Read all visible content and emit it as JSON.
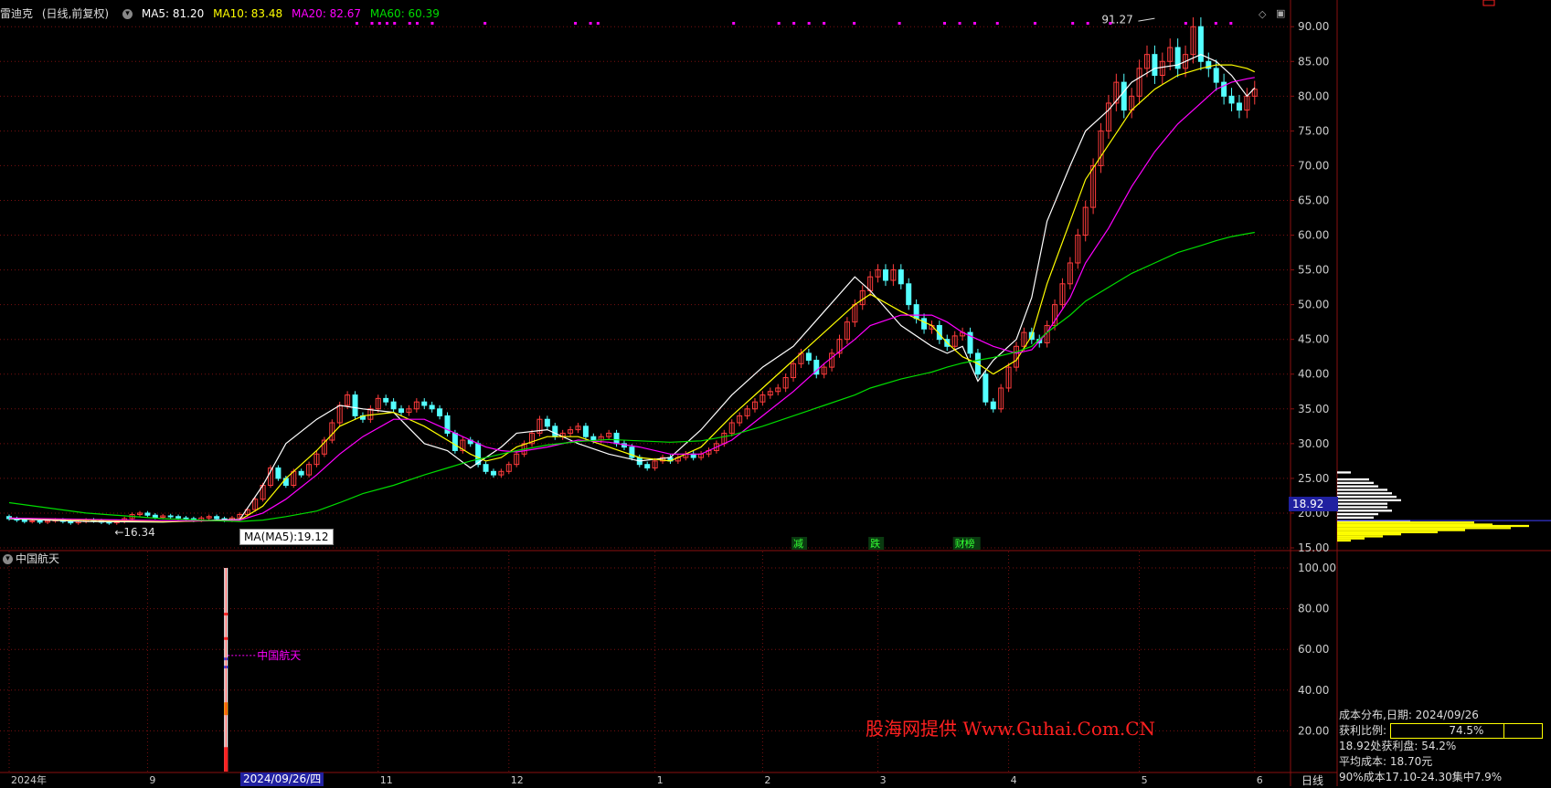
{
  "legend": {
    "stock_name": "雷迪克",
    "mode": "(日线,前复权)",
    "ma5": "MA5: 81.20",
    "ma10": "MA10: 83.48",
    "ma20": "MA20: 82.67",
    "ma60": "MA60: 60.39"
  },
  "colors": {
    "up": "#ff3c3c",
    "down": "#54ffff",
    "ma5": "#ffffff",
    "ma10": "#ffff00",
    "ma20": "#ff00ff",
    "ma60": "#00dd00",
    "grid": "#7a1010"
  },
  "sub_panel": {
    "title": "中国航天",
    "indicator_label": "中国航天"
  },
  "markers": {
    "high_label": "91.27",
    "low_label": "16.34",
    "ma_tooltip": "MA(MA5):19.12",
    "current_price": "18.92",
    "selected_date": "2024/09/26/四",
    "period": "日线",
    "event_tags": [
      "减",
      "跌",
      "财榜"
    ]
  },
  "cost_distribution": {
    "title": "成本分布,日期:  2024/09/26",
    "profit_ratio_label": "获利比例:",
    "profit_ratio_value": "74.5%",
    "profit_ratio": 0.745,
    "profit_at_price": "18.92处获利盘:  54.2%",
    "avg_cost": "平均成本:  18.70元",
    "concentration": "90%成本17.10-24.30集中7.9%"
  },
  "watermark": "股海网提供 Www.Guhai.Com.CN",
  "chart_data": {
    "type": "line",
    "title": "雷迪克 (日线,前复权)",
    "y_ticks": [
      "90.00",
      "85.00",
      "80.00",
      "75.00",
      "70.00",
      "65.00",
      "60.00",
      "55.00",
      "50.00",
      "45.00",
      "40.00",
      "35.00",
      "30.00",
      "25.00",
      "20.00",
      "15.00"
    ],
    "ylim": [
      15,
      92
    ],
    "sub_y_ticks": [
      "100.00",
      "80.00",
      "60.00",
      "40.00",
      "20.00"
    ],
    "sub_ylim": [
      0,
      100
    ],
    "x_ticks": [
      "2024年",
      "9",
      "11",
      "12",
      "1",
      "2",
      "3",
      "4",
      "5",
      "6"
    ],
    "x_tick_positions": [
      0,
      18,
      48,
      65,
      84,
      98,
      113,
      130,
      147,
      162
    ],
    "n_bars": 165,
    "series": [
      {
        "name": "MA5",
        "x": [
          0,
          10,
          20,
          27,
          30,
          33,
          36,
          40,
          43,
          46,
          50,
          54,
          57,
          60,
          62,
          64,
          66,
          70,
          74,
          78,
          82,
          86,
          90,
          94,
          98,
          102,
          106,
          110,
          112,
          116,
          120,
          122,
          124,
          126,
          128,
          131,
          133,
          135,
          138,
          140,
          143,
          146,
          149,
          152,
          155,
          157,
          159,
          161,
          162
        ],
        "values": [
          19.2,
          18.8,
          18.7,
          19.0,
          19.1,
          24.0,
          30.0,
          33.5,
          35.5,
          35.0,
          34.5,
          30.0,
          29.0,
          26.5,
          28.0,
          29.5,
          31.5,
          32.0,
          30.0,
          28.5,
          27.5,
          28.0,
          32.0,
          37.0,
          41.0,
          44.0,
          49.0,
          54.0,
          52.0,
          47.0,
          44.0,
          43.0,
          44.0,
          39.0,
          42.0,
          45.0,
          51.0,
          62.0,
          70.0,
          75.0,
          78.0,
          82.0,
          84.0,
          84.5,
          86.0,
          85.0,
          83.0,
          80.0,
          81.2
        ]
      },
      {
        "name": "MA10",
        "x": [
          0,
          10,
          20,
          27,
          30,
          33,
          36,
          40,
          43,
          46,
          50,
          54,
          57,
          60,
          62,
          64,
          66,
          70,
          74,
          78,
          82,
          86,
          90,
          94,
          98,
          102,
          106,
          110,
          112,
          116,
          120,
          122,
          124,
          126,
          128,
          131,
          133,
          135,
          138,
          140,
          143,
          146,
          149,
          152,
          155,
          157,
          159,
          161,
          162
        ],
        "values": [
          19.3,
          19.0,
          18.8,
          18.9,
          19.0,
          21.0,
          25.0,
          29.0,
          32.5,
          34.0,
          34.5,
          32.5,
          30.5,
          28.5,
          27.5,
          28.0,
          29.5,
          31.0,
          31.0,
          29.5,
          28.0,
          27.5,
          29.5,
          34.0,
          38.0,
          42.0,
          46.0,
          50.0,
          51.5,
          49.0,
          47.0,
          44.5,
          42.5,
          41.5,
          40.0,
          42.0,
          45.5,
          53.0,
          62.0,
          68.0,
          73.0,
          78.0,
          81.0,
          83.0,
          84.0,
          84.5,
          84.5,
          84.0,
          83.5
        ]
      },
      {
        "name": "MA20",
        "x": [
          0,
          10,
          20,
          27,
          30,
          33,
          36,
          40,
          43,
          46,
          50,
          54,
          57,
          60,
          62,
          64,
          66,
          70,
          74,
          78,
          82,
          86,
          90,
          94,
          98,
          102,
          106,
          110,
          112,
          116,
          120,
          122,
          124,
          126,
          128,
          131,
          133,
          135,
          138,
          140,
          143,
          146,
          149,
          152,
          155,
          157,
          159,
          161,
          162
        ],
        "values": [
          19.3,
          19.1,
          18.9,
          18.9,
          19.0,
          20.0,
          22.0,
          25.5,
          28.5,
          31.0,
          33.5,
          33.5,
          32.0,
          30.5,
          29.5,
          29.0,
          28.8,
          29.5,
          30.5,
          30.2,
          29.5,
          28.5,
          28.5,
          30.5,
          34.0,
          37.5,
          41.5,
          45.0,
          47.0,
          48.5,
          48.5,
          47.5,
          46.0,
          45.0,
          44.0,
          43.0,
          43.5,
          46.0,
          51.0,
          56.0,
          61.0,
          67.0,
          72.0,
          76.0,
          79.0,
          81.0,
          82.0,
          82.5,
          82.7
        ]
      },
      {
        "name": "MA60",
        "x": [
          0,
          10,
          20,
          27,
          30,
          33,
          36,
          40,
          43,
          46,
          50,
          54,
          57,
          60,
          62,
          64,
          66,
          70,
          74,
          78,
          82,
          86,
          90,
          94,
          98,
          102,
          106,
          110,
          112,
          116,
          120,
          122,
          124,
          126,
          128,
          131,
          133,
          135,
          138,
          140,
          143,
          146,
          149,
          152,
          155,
          157,
          159,
          161,
          162
        ],
        "values": [
          21.5,
          20.0,
          19.2,
          18.9,
          18.8,
          19.0,
          19.5,
          20.3,
          21.5,
          22.8,
          24.0,
          25.5,
          26.5,
          27.5,
          28.0,
          28.5,
          29.0,
          29.8,
          30.3,
          30.6,
          30.4,
          30.2,
          30.4,
          31.2,
          32.5,
          34.0,
          35.5,
          37.0,
          38.0,
          39.3,
          40.3,
          41.0,
          41.6,
          42.0,
          42.4,
          43.2,
          44.0,
          46.0,
          48.5,
          50.5,
          52.5,
          54.5,
          56.0,
          57.5,
          58.5,
          59.2,
          59.8,
          60.2,
          60.4
        ]
      }
    ],
    "candles": {
      "open": [
        19.5,
        19.2,
        19.0,
        18.8,
        18.9,
        18.7,
        18.9,
        19.0,
        18.8,
        18.6,
        18.8,
        19.0,
        18.9,
        18.7,
        18.6,
        18.8,
        19.2,
        19.8,
        20.0,
        19.7,
        19.4,
        19.6,
        19.5,
        19.3,
        19.2,
        19.0,
        19.3,
        19.5,
        19.2,
        19.0,
        19.3,
        19.8,
        20.5,
        22.0,
        24.0,
        26.5,
        25.0,
        24.0,
        26.0,
        25.5,
        27.0,
        28.5,
        30.5,
        33.0,
        35.5,
        37.0,
        34.0,
        33.5,
        35.0,
        36.5,
        36.0,
        35.0,
        34.5,
        35.0,
        36.0,
        35.5,
        35.0,
        34.0,
        31.5,
        29.0,
        30.5,
        30.0,
        27.0,
        26.0,
        25.5,
        26.0,
        27.0,
        28.5,
        30.0,
        31.5,
        33.5,
        32.5,
        31.0,
        31.5,
        32.0,
        32.5,
        31.0,
        30.5,
        31.0,
        31.5,
        30.0,
        29.5,
        28.0,
        27.0,
        26.5,
        27.5,
        28.0,
        27.5,
        28.0,
        28.5,
        28.0,
        28.5,
        29.0,
        30.0,
        31.5,
        33.0,
        34.0,
        35.0,
        36.0,
        37.0,
        37.5,
        38.0,
        39.5,
        41.5,
        43.0,
        42.0,
        40.0,
        41.0,
        43.0,
        45.0,
        47.5,
        50.0,
        52.0,
        54.0,
        55.0,
        53.5,
        55.0,
        53.0,
        50.0,
        48.0,
        46.5,
        47.0,
        45.0,
        44.0,
        45.5,
        46.0,
        43.0,
        40.0,
        36.0,
        35.0,
        38.0,
        41.0,
        44.0,
        46.0,
        45.0,
        44.5,
        47.0,
        50.0,
        53.0,
        56.0,
        60.0,
        64.0,
        70.0,
        75.0,
        79.0,
        82.0,
        78.0,
        80.0,
        84.0,
        86.0,
        83.0,
        85.0,
        87.0,
        84.0,
        86.0,
        90.0,
        85.0,
        84.0,
        82.0,
        80.0,
        79.0,
        78.0,
        80.0
      ],
      "close": [
        19.2,
        19.0,
        18.8,
        18.9,
        18.7,
        18.9,
        19.0,
        18.8,
        18.6,
        18.8,
        19.0,
        18.9,
        18.7,
        18.6,
        18.8,
        19.2,
        19.8,
        20.0,
        19.7,
        19.4,
        19.6,
        19.5,
        19.3,
        19.2,
        19.0,
        19.3,
        19.5,
        19.2,
        19.0,
        19.3,
        19.8,
        20.5,
        22.0,
        24.0,
        26.5,
        25.0,
        24.0,
        26.0,
        25.5,
        27.0,
        28.5,
        30.5,
        33.0,
        35.5,
        37.0,
        34.0,
        33.5,
        35.0,
        36.5,
        36.0,
        35.0,
        34.5,
        35.0,
        36.0,
        35.5,
        35.0,
        34.0,
        31.5,
        29.0,
        30.5,
        30.0,
        27.0,
        26.0,
        25.5,
        26.0,
        27.0,
        28.5,
        30.0,
        31.5,
        33.5,
        32.5,
        31.0,
        31.5,
        32.0,
        32.5,
        31.0,
        30.5,
        31.0,
        31.5,
        30.0,
        29.5,
        28.0,
        27.0,
        26.5,
        27.5,
        28.0,
        27.5,
        28.0,
        28.5,
        28.0,
        28.5,
        29.0,
        30.0,
        31.5,
        33.0,
        34.0,
        35.0,
        36.0,
        37.0,
        37.5,
        38.0,
        39.5,
        41.5,
        43.0,
        42.0,
        40.0,
        41.0,
        43.0,
        45.0,
        47.5,
        50.0,
        52.0,
        54.0,
        55.0,
        53.5,
        55.0,
        53.0,
        50.0,
        48.0,
        46.5,
        47.0,
        45.0,
        44.0,
        45.5,
        46.0,
        43.0,
        40.0,
        36.0,
        35.0,
        38.0,
        41.0,
        44.0,
        46.0,
        45.0,
        44.5,
        47.0,
        50.0,
        53.0,
        56.0,
        60.0,
        64.0,
        70.0,
        75.0,
        79.0,
        82.0,
        78.0,
        80.0,
        84.0,
        86.0,
        83.0,
        85.0,
        87.0,
        84.0,
        86.0,
        90.0,
        85.0,
        84.0,
        82.0,
        80.0,
        79.0,
        78.0,
        80.0,
        81.0
      ]
    }
  }
}
